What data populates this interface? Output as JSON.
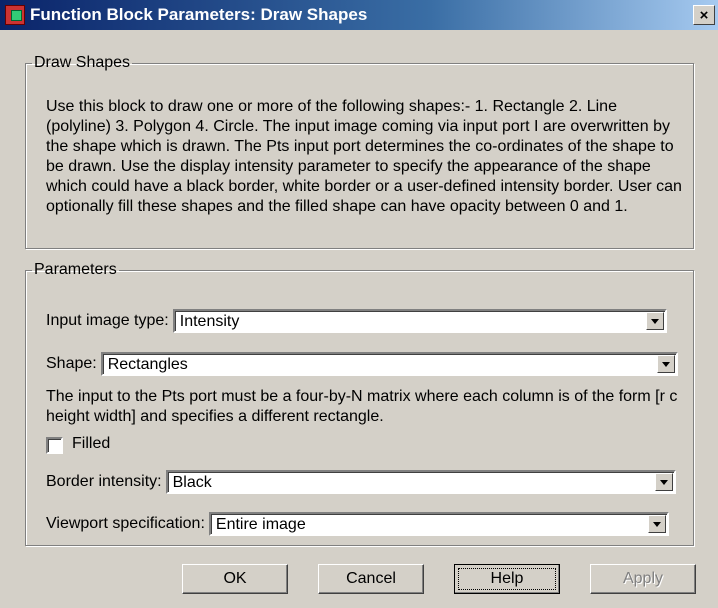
{
  "window": {
    "title": "Function Block Parameters: Draw Shapes",
    "close_label": "×"
  },
  "description_group": {
    "legend": "Draw Shapes",
    "text": "Use this block to draw one or more of the following shapes:- 1. Rectangle 2. Line (polyline) 3. Polygon 4. Circle. The input image coming via input port I are overwritten by the shape which is drawn. The Pts input port determines the co-ordinates of the shape to be drawn. Use the display intensity parameter to specify the appearance of the shape which could have a black border, white border or a user-defined intensity border. User can optionally fill these shapes and the filled shape can have opacity between 0 and 1."
  },
  "parameters": {
    "legend": "Parameters",
    "input_image_type": {
      "label": "Input image type:",
      "value": "Intensity"
    },
    "shape": {
      "label": "Shape:",
      "value": "Rectangles"
    },
    "pts_note": "The input to the Pts port must be a four-by-N matrix where each column is of the form [r c height width] and specifies a different rectangle.",
    "filled": {
      "label": "Filled",
      "checked": false
    },
    "border_intensity": {
      "label": "Border intensity:",
      "value": "Black"
    },
    "viewport": {
      "label": "Viewport specification:",
      "value": "Entire image"
    }
  },
  "buttons": {
    "ok": "OK",
    "cancel": "Cancel",
    "help": "Help",
    "apply": "Apply"
  }
}
